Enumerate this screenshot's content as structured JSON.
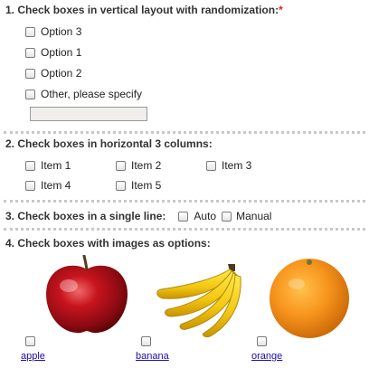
{
  "q1": {
    "title": "1. Check boxes in vertical layout with randomization:",
    "required_mark": "*",
    "options": [
      "Option 3",
      "Option 1",
      "Option 2",
      "Other, please specify"
    ],
    "other_value": ""
  },
  "q2": {
    "title": "2. Check boxes in horizontal 3 columns:",
    "options": [
      "Item 1",
      "Item 2",
      "Item 3",
      "Item 4",
      "Item 5"
    ]
  },
  "q3": {
    "title": "3. Check boxes in a single line:",
    "options": [
      "Auto",
      "Manual"
    ]
  },
  "q4": {
    "title": "4. Check boxes with images as options:",
    "options": [
      {
        "label": "apple",
        "icon": "apple-image"
      },
      {
        "label": "banana",
        "icon": "banana-image"
      },
      {
        "label": "orange",
        "icon": "orange-image"
      }
    ]
  },
  "colors": {
    "required": "#e0201c",
    "divider": "#c8c8c8",
    "link": "#1a0dab",
    "input_bg": "#efeeea"
  }
}
